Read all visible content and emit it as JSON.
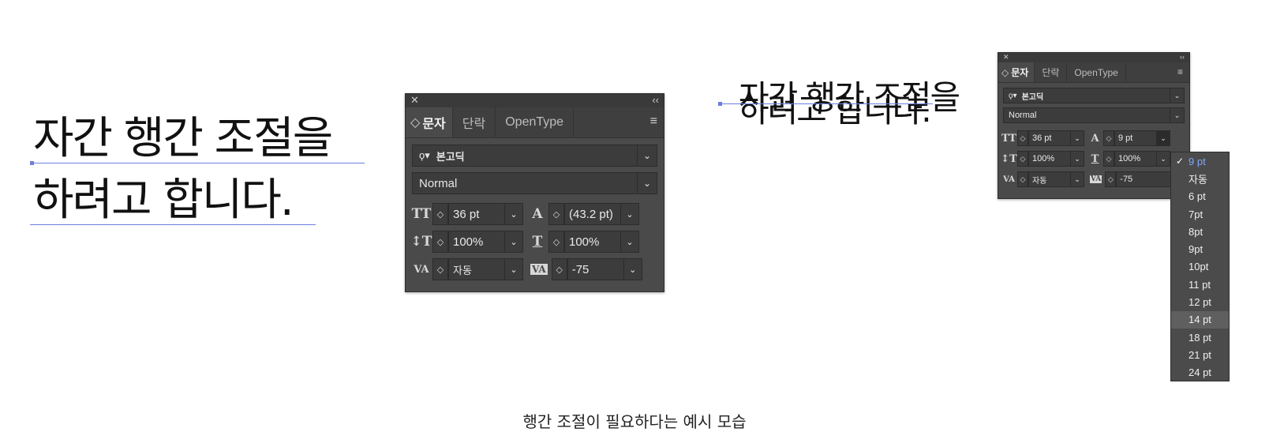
{
  "sample_text": {
    "line1": "자간 행간 조절을",
    "line2": "하려고 합니다."
  },
  "panel": {
    "close_icon": "✕",
    "collapse_icon": "‹‹",
    "tabs": [
      {
        "label": "문자",
        "sorter": "◇"
      },
      {
        "label": "단락"
      },
      {
        "label": "OpenType"
      }
    ],
    "menu_icon": "≡",
    "font_search_icon": "ϙ▾",
    "font_family": "본고딕",
    "font_style": "Normal"
  },
  "panel_large": {
    "font_size": "36 pt",
    "leading": "(43.2 pt)",
    "vertical_scale": "100%",
    "horizontal_scale": "100%",
    "kerning": "자동",
    "tracking": "-75"
  },
  "panel_small": {
    "font_size": "36 pt",
    "leading": "9 pt",
    "vertical_scale": "100%",
    "horizontal_scale": "100%",
    "kerning": "자동",
    "tracking": "-75"
  },
  "icons": {
    "font_size": "TT",
    "leading": "A",
    "vertical_scale": "↕T",
    "horizontal_scale": "T",
    "kerning": "VA",
    "tracking": "VA",
    "spinner": "◇",
    "chevron": "⌄",
    "check": "✓"
  },
  "leading_dropdown": {
    "items": [
      "9 pt",
      "자동",
      "6 pt",
      "7pt",
      "8pt",
      "9pt",
      "10pt",
      "11 pt",
      "12 pt",
      "14 pt",
      "18 pt",
      "21 pt",
      "24 pt"
    ],
    "selected": "9 pt",
    "hovered": "14 pt"
  },
  "colors": {
    "panel_bg": "#4a4a4a",
    "baseline": "#6d7fe0",
    "selected_item": "#7fa7ff"
  },
  "caption": "행간 조절이 필요하다는 예시 모습"
}
